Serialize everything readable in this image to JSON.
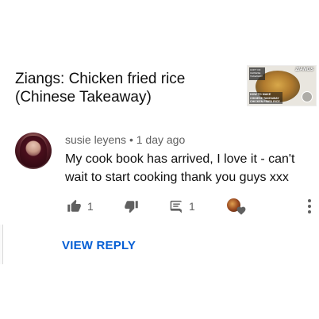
{
  "video": {
    "title": "Ziangs: Chicken fried rice (Chinese Takeaway)",
    "thumbnail": {
      "brand": "ZIANGS",
      "caption": "HOW TO MAKE CHINESE TAKEAWAY CHICKEN FRIED RICE",
      "badge": "COPY OF CHINESE TAKEAWAY"
    }
  },
  "comment": {
    "author": "susie leyens",
    "separator": "•",
    "time": "1 day ago",
    "text": "My cook book has arrived, I love it - can't wait to start cooking thank you guys xxx",
    "likes": "1",
    "replies": "1"
  },
  "actions": {
    "like_icon": "thumbs-up-icon",
    "dislike_icon": "thumbs-down-icon",
    "reply_icon": "reply-icon",
    "creator_heart_icon": "creator-heart-icon",
    "more_icon": "more-vert-icon"
  },
  "view_reply_label": "VIEW REPLY",
  "colors": {
    "link_blue": "#065fd4",
    "icon_gray": "#606060"
  }
}
